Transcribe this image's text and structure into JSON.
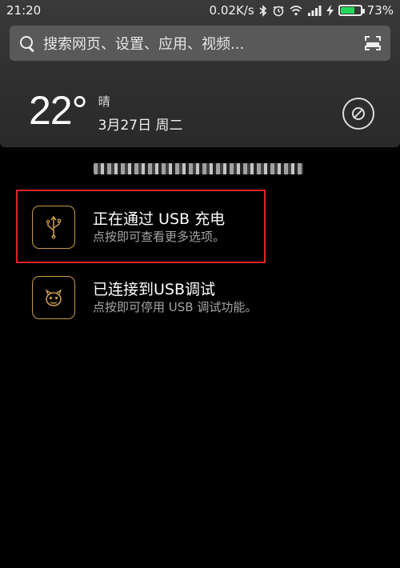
{
  "status_bar": {
    "time": "21:20",
    "net_speed": "0.02K/s",
    "battery_percent": "73%",
    "battery_level": 0.73,
    "battery_color": "#27d95a",
    "icons": [
      "bluetooth-icon",
      "alarm-icon",
      "wifi-icon",
      "signal-icon",
      "charging-bolt-icon"
    ]
  },
  "search": {
    "placeholder": "搜索网页、设置、应用、视频..."
  },
  "weather": {
    "temperature": "22°",
    "condition": "晴",
    "date": "3月27日 周二"
  },
  "notifications": [
    {
      "title": "正在通过 USB 充电",
      "subtitle": "点按即可查看更多选项。",
      "icon": "usb-icon"
    },
    {
      "title": "已连接到USB调试",
      "subtitle": "点按即可停用 USB 调试功能。",
      "icon": "debug-bug-icon"
    }
  ],
  "colors": {
    "highlight": "#e12424",
    "icon_border": "#c79a4a",
    "search_bg": "#595959"
  }
}
